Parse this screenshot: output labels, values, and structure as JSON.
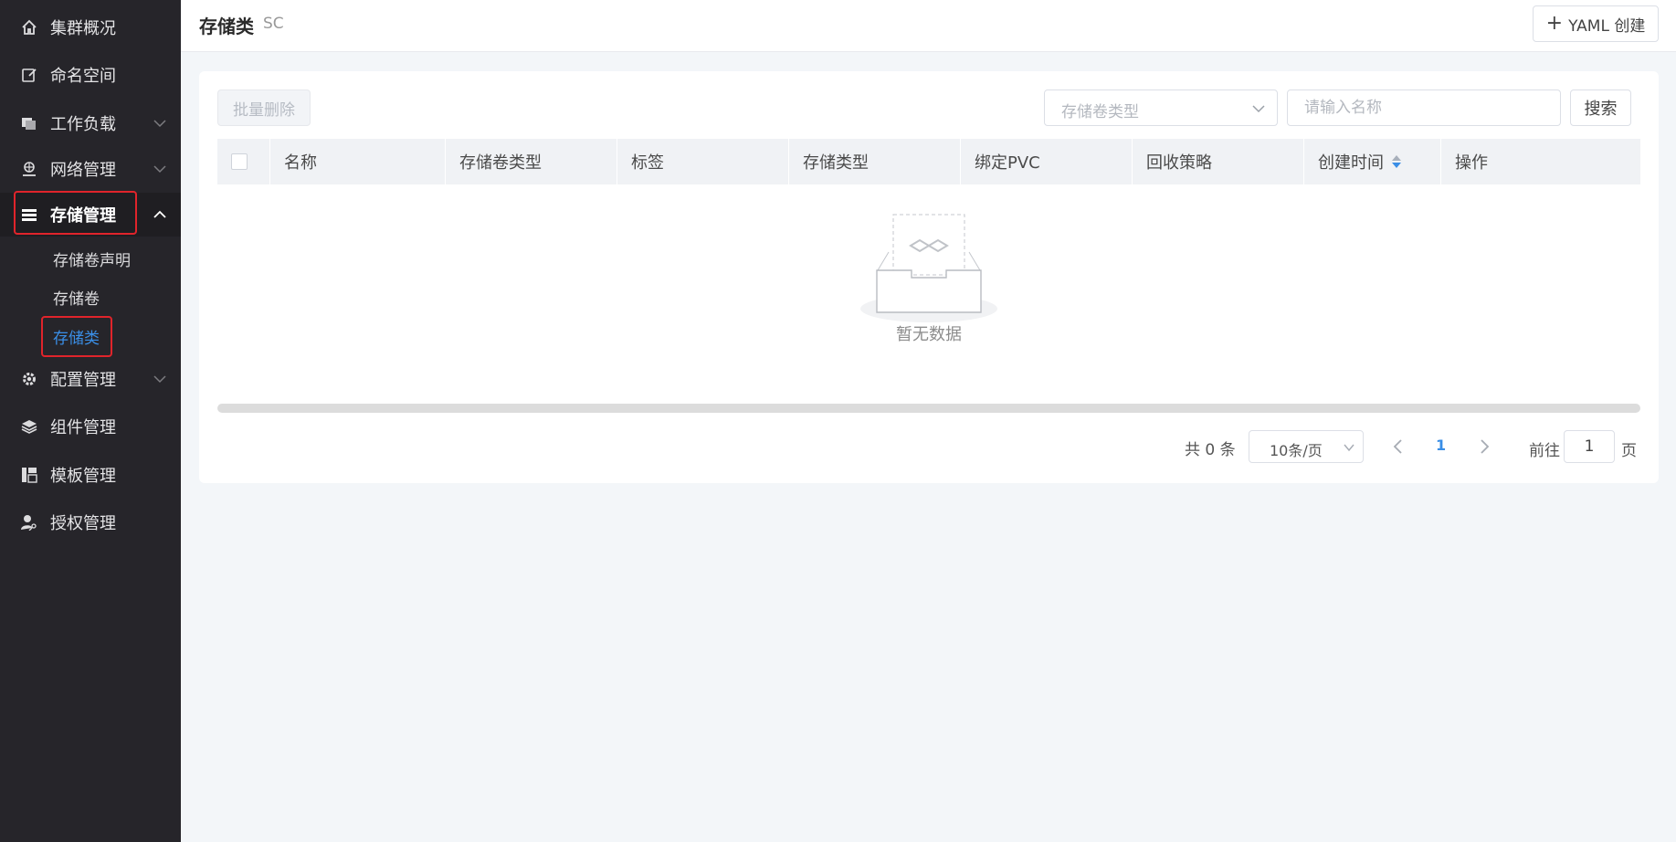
{
  "sidebar": {
    "items": [
      {
        "label": "集群概况",
        "icon": "home-icon"
      },
      {
        "label": "命名空间",
        "icon": "edit-icon"
      },
      {
        "label": "工作负载",
        "icon": "copy-icon"
      },
      {
        "label": "网络管理",
        "icon": "network-icon"
      },
      {
        "label": "存储管理",
        "icon": "storage-icon"
      },
      {
        "label": "配置管理",
        "icon": "gear-icon"
      },
      {
        "label": "组件管理",
        "icon": "layers-icon"
      },
      {
        "label": "模板管理",
        "icon": "template-icon"
      },
      {
        "label": "授权管理",
        "icon": "user-key-icon"
      }
    ],
    "storage_sub": [
      {
        "label": "存储卷声明"
      },
      {
        "label": "存储卷"
      },
      {
        "label": "存储类"
      }
    ]
  },
  "header": {
    "title": "存储类",
    "subtitle": "SC",
    "yaml_button": "YAML 创建"
  },
  "toolbar": {
    "batch_delete": "批量删除",
    "type_select_placeholder": "存储卷类型",
    "search_placeholder": "请输入名称",
    "search_button": "搜索"
  },
  "table": {
    "columns": [
      "名称",
      "存储卷类型",
      "标签",
      "存储类型",
      "绑定PVC",
      "回收策略",
      "创建时间",
      "操作"
    ],
    "empty_text": "暂无数据"
  },
  "pagination": {
    "total": "共 0 条",
    "page_size": "10条/页",
    "current_page": "1",
    "goto_label": "前往",
    "goto_value": "1",
    "page_suffix": "页"
  },
  "colors": {
    "sidebar_bg": "#26252a",
    "accent": "#3a8ee6",
    "highlight_box": "#e0242b"
  }
}
